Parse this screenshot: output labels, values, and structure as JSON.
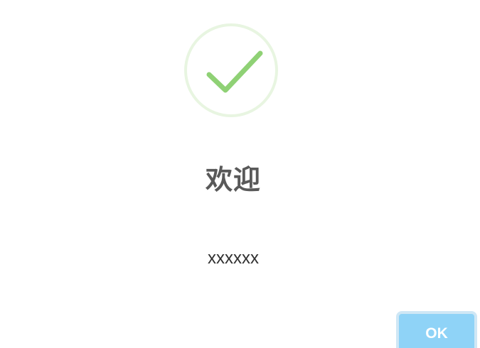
{
  "dialog": {
    "icon": "success-checkmark-icon",
    "title": "欢迎",
    "message": "xxxxxx",
    "confirm_label": "OK"
  },
  "colors": {
    "checkmark": "#8fd175",
    "ring": "#e8f5e1",
    "button": "#8fd3f7",
    "title_text": "#595959"
  }
}
